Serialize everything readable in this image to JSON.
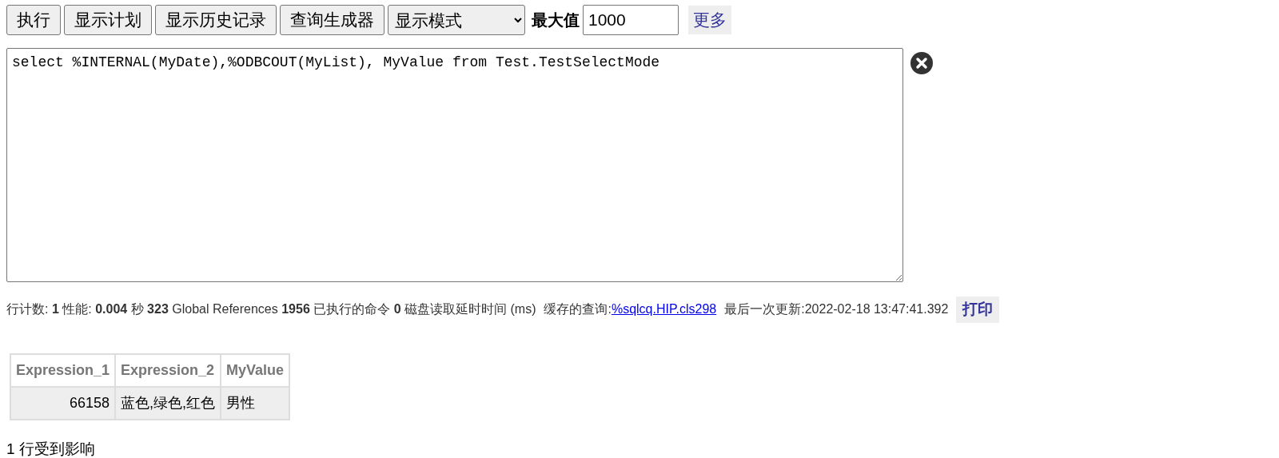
{
  "toolbar": {
    "buttons": [
      "执行",
      "显示计划",
      "显示历史记录",
      "查询生成器"
    ],
    "mode_select": {
      "value": "显示模式"
    },
    "max_label": "最大值",
    "max_field": {
      "value": "1000"
    },
    "more_link": "更多"
  },
  "query": {
    "value": "select %INTERNAL(MyDate),%ODBCOUT(MyList), MyValue from Test.TestSelectMode"
  },
  "stats": {
    "text": "行计数: **1** 性能: **0.004** 秒  **323** Global References **1956** 已执行的命令 **0** 磁盘读取延时时间 (ms)",
    "cached_label": "缓存的查询:",
    "cached_link": "%sqlcq.HIP.cls298",
    "last_update": "最后一次更新:2022-02-18 13:47:41.392",
    "print_button": "打印"
  },
  "table": {
    "columns": [
      "Expression_1",
      "Expression_2",
      "MyValue"
    ],
    "rows": [
      [
        "66158",
        "蓝色,绿色,红色",
        "男性"
      ]
    ]
  },
  "footer": "1 行受到影响"
}
